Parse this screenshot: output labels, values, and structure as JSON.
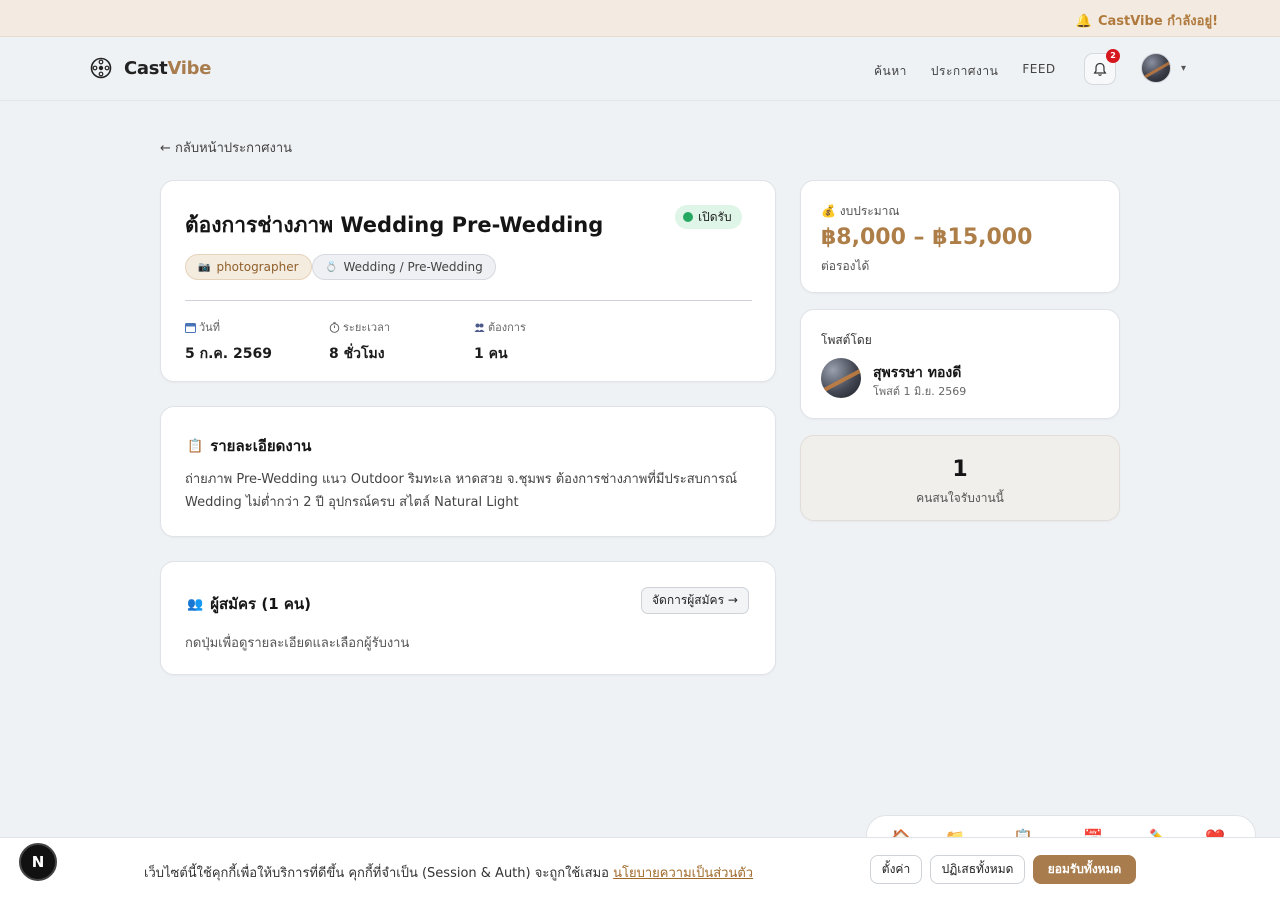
{
  "banner": {
    "text": "CastVibe กำลังอยู่!"
  },
  "nav": {
    "brand_a": "Cast",
    "brand_b": "Vibe",
    "links": [
      "ค้นหา",
      "ประกาศงาน",
      "FEED"
    ],
    "notification_count": "2"
  },
  "back_link": "← กลับหน้าประกาศงาน",
  "job": {
    "title": "ต้องการช่างภาพ Wedding Pre-Wedding",
    "status": "เปิดรับ",
    "status_color": "#26a862",
    "tags": [
      "photographer",
      "Wedding / Pre-Wedding"
    ],
    "meta": [
      {
        "label": "วันที่",
        "value": "5 ก.ค. 2569",
        "icon": "calendar-icon"
      },
      {
        "label": "ระยะเวลา",
        "value": "8 ชั่วโมง",
        "icon": "stopwatch-icon"
      },
      {
        "label": "ต้องการ",
        "value": "1 คน",
        "icon": "people-icon"
      }
    ]
  },
  "details": {
    "title": "รายละเอียดงาน",
    "body": "ถ่ายภาพ Pre-Wedding แนว Outdoor ริมทะเล หาดสวย จ.ชุมพร ต้องการช่างภาพที่มีประสบการณ์ Wedding ไม่ต่ำกว่า 2 ปี อุปกรณ์ครบ สไตล์ Natural Light"
  },
  "applicants": {
    "title": "ผู้สมัคร (1 คน)",
    "manage_label": "จัดการผู้สมัคร →",
    "hint": "กดปุ่มเพื่อดูรายละเอียดและเลือกผู้รับงาน"
  },
  "budget": {
    "label": "งบประมาณ",
    "value": "฿8,000 – ฿15,000",
    "negotiable": "ต่อรองได้",
    "accent_color": "#ad7e48"
  },
  "poster": {
    "label": "โพสต์โดย",
    "name": "สุพรรษา ทองดี",
    "date": "โพสต์ 1 มิ.ย. 2569"
  },
  "interest": {
    "count": "1",
    "label": "คนสนใจรับงานนี้"
  },
  "cookie": {
    "message": "เว็บไซต์นี้ใช้คุกกี้เพื่อให้บริการที่ดีขึ้น คุกกี้ที่จำเป็น (Session & Auth) จะถูกใช้เสมอ ",
    "policy_link": "นโยบายความเป็นส่วนตัว",
    "settings": "ตั้งค่า",
    "reject": "ปฏิเสธทั้งหมด",
    "accept": "ยอมรับทั้งหมด",
    "accept_color": "#a87c4d"
  },
  "next_badge": "N"
}
